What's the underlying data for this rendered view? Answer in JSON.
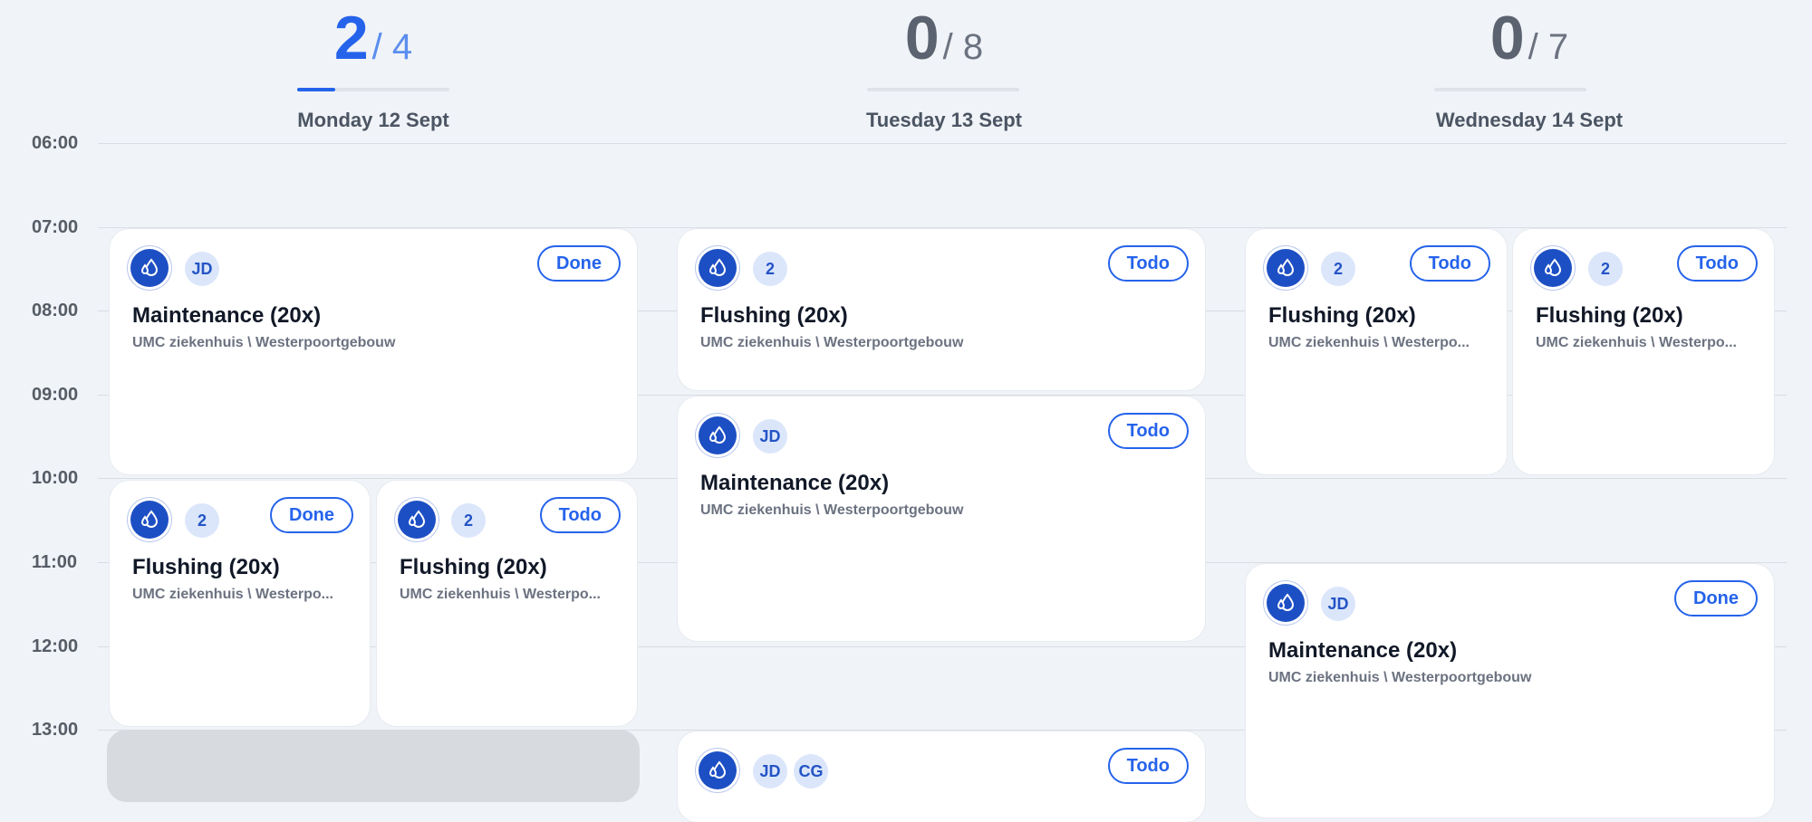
{
  "days": [
    {
      "done": "2",
      "total": "/ 4",
      "label": "Monday 12 Sept",
      "progress": 0.25
    },
    {
      "done": "0",
      "total": "/ 8",
      "label": "Tuesday 13 Sept",
      "progress": 0
    },
    {
      "done": "0",
      "total": "/ 7",
      "label": "Wednesday 14 Sept",
      "progress": 0
    }
  ],
  "times": [
    "06:00",
    "07:00",
    "08:00",
    "09:00",
    "10:00",
    "11:00",
    "12:00",
    "13:00"
  ],
  "icons": {
    "task": "water-drop-icon"
  },
  "colors": {
    "accent": "#2563eb",
    "icon_bg": "#1d4fc4",
    "background": "#f0f3f7"
  },
  "cards": [
    {
      "title": "Maintenance (20x)",
      "subtitle": "UMC ziekenhuis \\ Westerpoortgebouw",
      "avatars": [
        "JD"
      ],
      "status": "Done"
    },
    {
      "title": "Flushing (20x)",
      "subtitle": "UMC ziekenhuis \\ Westerpo...",
      "avatars": [
        "2"
      ],
      "status": "Done"
    },
    {
      "title": "Flushing (20x)",
      "subtitle": "UMC ziekenhuis \\ Westerpo...",
      "avatars": [
        "2"
      ],
      "status": "Todo"
    },
    {
      "title": "Flushing (20x)",
      "subtitle": "UMC ziekenhuis \\ Westerpoortgebouw",
      "avatars": [
        "2"
      ],
      "status": "Todo"
    },
    {
      "title": "Maintenance (20x)",
      "subtitle": "UMC ziekenhuis \\ Westerpoortgebouw",
      "avatars": [
        "JD"
      ],
      "status": "Todo"
    },
    {
      "title": "",
      "subtitle": "",
      "avatars": [
        "JD",
        "CG"
      ],
      "status": "Todo"
    },
    {
      "title": "Flushing (20x)",
      "subtitle": "UMC ziekenhuis \\ Westerpo...",
      "avatars": [
        "2"
      ],
      "status": "Todo"
    },
    {
      "title": "Flushing (20x)",
      "subtitle": "UMC ziekenhuis \\ Westerpo...",
      "avatars": [
        "2"
      ],
      "status": "Todo"
    },
    {
      "title": "Maintenance (20x)",
      "subtitle": "UMC ziekenhuis \\ Westerpoortgebouw",
      "avatars": [
        "JD"
      ],
      "status": "Done"
    }
  ]
}
